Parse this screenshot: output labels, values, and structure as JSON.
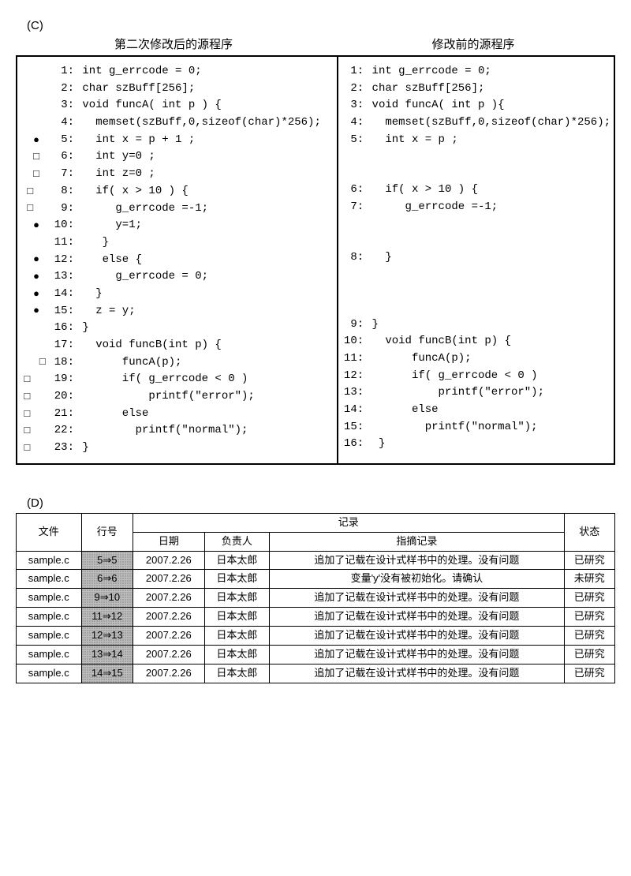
{
  "sectionC": {
    "label": "(C)",
    "heading_left": "第二次修改后的源程序",
    "heading_right": "修改前的源程序",
    "left_lines": [
      {
        "mark": "",
        "num": "1:",
        "text": " int g_errcode = 0;"
      },
      {
        "mark": "",
        "num": "2:",
        "text": " char szBuff[256];"
      },
      {
        "mark": "",
        "num": "3:",
        "text": " void funcA( int p ) {"
      },
      {
        "mark": "",
        "num": "4:",
        "text": "   memset(szBuff,0,sizeof(char)*256);"
      },
      {
        "mark": "●",
        "num": "5:",
        "text": "   int x = p + 1 ;"
      },
      {
        "mark": "□",
        "num": "6:",
        "text": "   int y=0 ;"
      },
      {
        "mark": "□",
        "num": "7:",
        "text": "   int z=0 ;"
      },
      {
        "mark": "□  ",
        "num": "8:",
        "text": "   if( x > 10 ) {"
      },
      {
        "mark": "□  ",
        "num": "9:",
        "text": "      g_errcode =-1;"
      },
      {
        "mark": "●",
        "num": "10:",
        "text": "      y=1;"
      },
      {
        "mark": "",
        "num": "11:",
        "text": "    }"
      },
      {
        "mark": "●",
        "num": "12:",
        "text": "    else {"
      },
      {
        "mark": "●",
        "num": "13:",
        "text": "      g_errcode = 0;"
      },
      {
        "mark": "●",
        "num": "14:",
        "text": "   }"
      },
      {
        "mark": "●",
        "num": "15:",
        "text": "   z = y;"
      },
      {
        "mark": "",
        "num": "16:",
        "text": " }"
      },
      {
        "mark": "",
        "num": "17:",
        "text": "   void funcB(int p) {"
      },
      {
        "mark": "  □",
        "num": "18:",
        "text": "       funcA(p);"
      },
      {
        "mark": "□   ",
        "num": "19:",
        "text": "       if( g_errcode < 0 )"
      },
      {
        "mark": "□   ",
        "num": "20:",
        "text": "           printf(\"error\");"
      },
      {
        "mark": "□   ",
        "num": "21:",
        "text": "       else"
      },
      {
        "mark": "□   ",
        "num": "22:",
        "text": "         printf(\"normal\");"
      },
      {
        "mark": "□   ",
        "num": "23:",
        "text": " }"
      }
    ],
    "right_lines": [
      {
        "num": "1:",
        "text": " int g_errcode = 0;"
      },
      {
        "num": "2:",
        "text": " char szBuff[256];"
      },
      {
        "num": "3:",
        "text": " void funcA( int p ){"
      },
      {
        "num": "4:",
        "text": "   memset(szBuff,0,sizeof(char)*256);"
      },
      {
        "num": "5:",
        "text": "   int x = p ;"
      },
      {
        "type": "spacer"
      },
      {
        "type": "spacer"
      },
      {
        "num": "6:",
        "text": "   if( x > 10 ) {"
      },
      {
        "num": "7:",
        "text": "      g_errcode =-1;"
      },
      {
        "type": "spacer"
      },
      {
        "type": "spacer"
      },
      {
        "num": "8:",
        "text": "   }"
      },
      {
        "type": "spacer"
      },
      {
        "type": "spacer"
      },
      {
        "type": "spacer"
      },
      {
        "num": "9:",
        "text": " }"
      },
      {
        "num": "10:",
        "text": "   void funcB(int p) {"
      },
      {
        "num": "11:",
        "text": "       funcA(p);"
      },
      {
        "num": "12:",
        "text": "       if( g_errcode < 0 )"
      },
      {
        "num": "13:",
        "text": "           printf(\"error\");"
      },
      {
        "num": "14:",
        "text": "       else"
      },
      {
        "num": "15:",
        "text": "         printf(\"normal\");"
      },
      {
        "num": "16:",
        "text": "  }"
      }
    ]
  },
  "sectionD": {
    "label": "(D)",
    "headers": {
      "file": "文件",
      "line": "行号",
      "record": "记录",
      "date": "日期",
      "person": "负责人",
      "note": "指摘记录",
      "status": "状态"
    },
    "rows": [
      {
        "file": "sample.c",
        "line": "5⇒5",
        "date": "2007.2.26",
        "person": "日本太郎",
        "note": "追加了记载在设计式样书中的处理。没有问题",
        "status": "已研究"
      },
      {
        "file": "sample.c",
        "line": "6⇒6",
        "date": "2007.2.26",
        "person": "日本太郎",
        "note": "变量'y'没有被初始化。请确认",
        "status": "未研究"
      },
      {
        "file": "sample.c",
        "line": "9⇒10",
        "date": "2007.2.26",
        "person": "日本太郎",
        "note": "追加了记载在设计式样书中的处理。没有问题",
        "status": "已研究"
      },
      {
        "file": "sample.c",
        "line": "11⇒12",
        "date": "2007.2.26",
        "person": "日本太郎",
        "note": "追加了记载在设计式样书中的处理。没有问题",
        "status": "已研究"
      },
      {
        "file": "sample.c",
        "line": "12⇒13",
        "date": "2007.2.26",
        "person": "日本太郎",
        "note": "追加了记载在设计式样书中的处理。没有问题",
        "status": "已研究"
      },
      {
        "file": "sample.c",
        "line": "13⇒14",
        "date": "2007.2.26",
        "person": "日本太郎",
        "note": "追加了记载在设计式样书中的处理。没有问题",
        "status": "已研究"
      },
      {
        "file": "sample.c",
        "line": "14⇒15",
        "date": "2007.2.26",
        "person": "日本太郎",
        "note": "追加了记载在设计式样书中的处理。没有问题",
        "status": "已研究"
      }
    ]
  }
}
